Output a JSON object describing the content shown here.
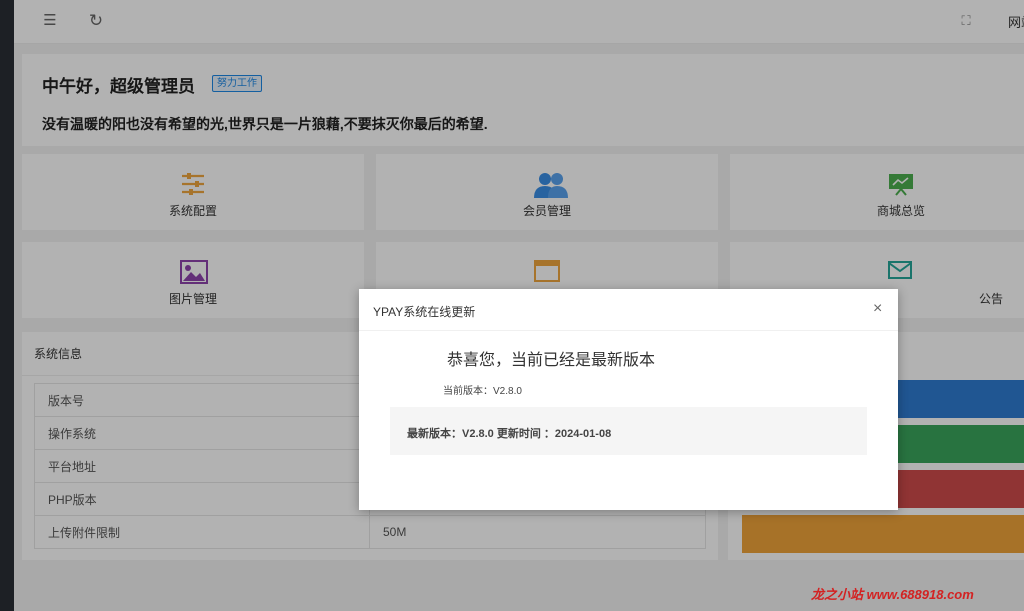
{
  "topbar": {
    "site_link": "网站"
  },
  "welcome": {
    "greeting": "中午好，超级管理员",
    "badge": "努力工作",
    "motto": "没有温暖的阳也没有希望的光,世界只是一片狼藉,不要抹灭你最后的希望."
  },
  "tiles": [
    {
      "label": "系统配置",
      "icon": "sliders-icon",
      "color": "#f0a640"
    },
    {
      "label": "会员管理",
      "icon": "users-icon",
      "color": "#3a8ee6"
    },
    {
      "label": "商城总览",
      "icon": "presentation-icon",
      "color": "#4caf50"
    },
    {
      "label": "图片管理",
      "icon": "image-icon",
      "color": "#8e44ad"
    },
    {
      "label": "",
      "icon": "window-icon",
      "color": "#f0a640"
    },
    {
      "label": "公告",
      "icon": "mail-icon",
      "color": "#26a69a"
    }
  ],
  "sysinfo": {
    "title": "系统信息",
    "rows": [
      {
        "key": "版本号",
        "value": ""
      },
      {
        "key": "操作系统",
        "value": ""
      },
      {
        "key": "平台地址",
        "value": ""
      },
      {
        "key": "PHP版本",
        "value": ""
      },
      {
        "key": "上传附件限制",
        "value": "50M"
      }
    ]
  },
  "right_bars": [
    {
      "color": "#2f7cd1"
    },
    {
      "color": "#3aa55c"
    },
    {
      "color": "#cf4b4b"
    },
    {
      "color": "#f0a43a"
    }
  ],
  "dialog": {
    "title": "YPAY系统在线更新",
    "close": "×",
    "message": "恭喜您，当前已经是最新版本",
    "current_version": "当前版本：V2.8.0",
    "latest_info": "最新版本：V2.8.0   更新时间 ：2024-01-08"
  },
  "watermark": "龙之小站 www.688918.com"
}
